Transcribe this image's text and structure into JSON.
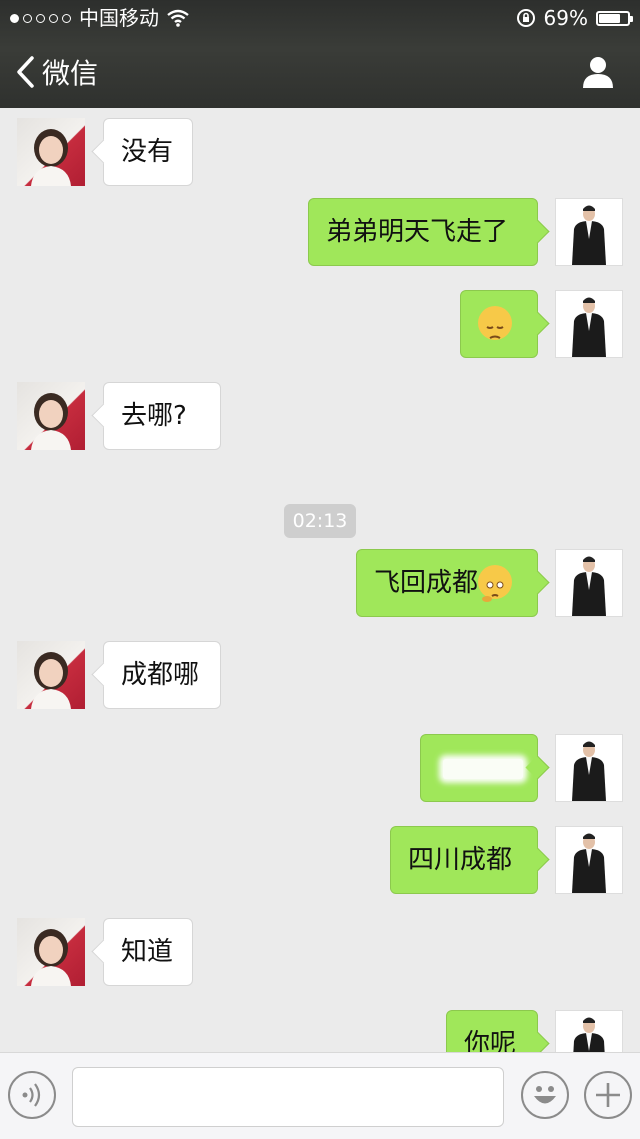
{
  "status": {
    "carrier": "中国移动",
    "battery": "69%",
    "battery_level": 0.69
  },
  "nav": {
    "back_label": "微信"
  },
  "messages": [
    {
      "side": "in",
      "text": "没有"
    },
    {
      "side": "out",
      "text": "弟弟明天飞走了"
    },
    {
      "side": "out",
      "text": "",
      "emoji": "pensive-face"
    },
    {
      "side": "in",
      "text": "去哪?"
    },
    {
      "side": "time",
      "text": "02:13"
    },
    {
      "side": "out",
      "text": "飞回成都",
      "emoji": "thinking-face"
    },
    {
      "side": "in",
      "text": "成都哪"
    },
    {
      "side": "out",
      "text": "",
      "redacted": true
    },
    {
      "side": "out",
      "text": "四川成都"
    },
    {
      "side": "in",
      "text": "知道"
    },
    {
      "side": "out",
      "text": "你呢"
    }
  ],
  "colors": {
    "outgoing_bubble": "#a0e75a",
    "incoming_bubble": "#ffffff",
    "background": "#ebebeb"
  }
}
